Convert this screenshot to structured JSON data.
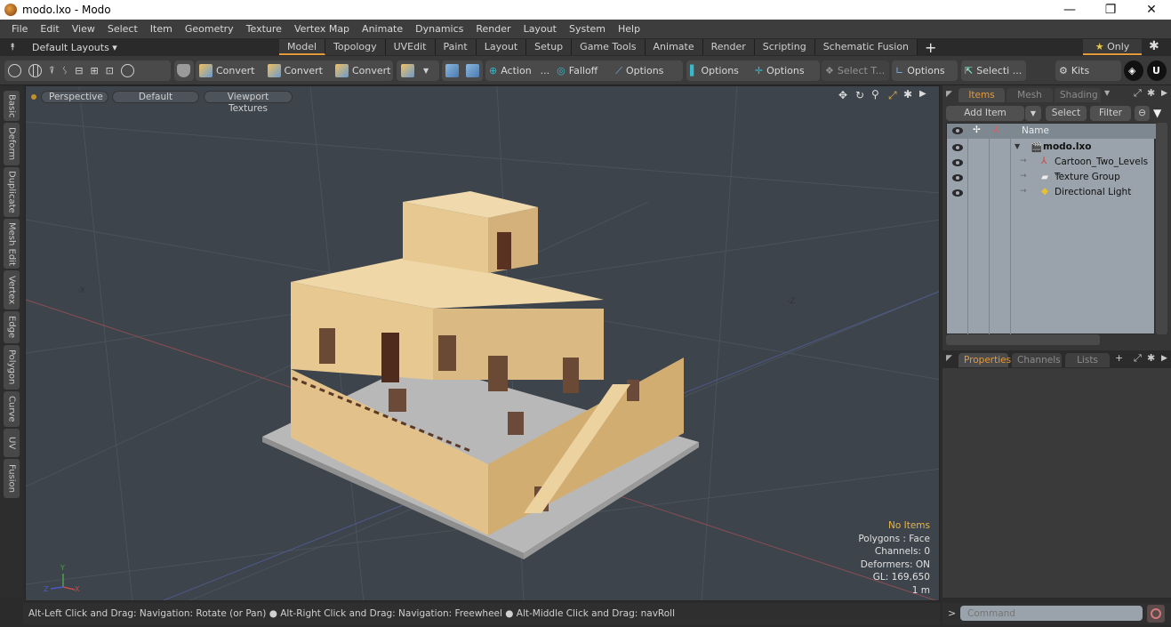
{
  "window": {
    "title": "modo.lxo - Modo",
    "controls": [
      "minimize-icon",
      "restore-icon",
      "close-icon"
    ]
  },
  "menu": [
    "File",
    "Edit",
    "View",
    "Select",
    "Item",
    "Geometry",
    "Texture",
    "Vertex Map",
    "Animate",
    "Dynamics",
    "Render",
    "Layout",
    "System",
    "Help"
  ],
  "layouts": {
    "dropdown_label": "Default Layouts ▾",
    "tabs": [
      "Model",
      "Topology",
      "UVEdit",
      "Paint",
      "Layout",
      "Setup",
      "Game Tools",
      "Animate",
      "Render",
      "Scripting",
      "Schematic Fusion"
    ],
    "active_tab": "Model",
    "add_label": "+",
    "only_label": "Only"
  },
  "toolbar": {
    "convert1": "Convert",
    "convert2": "Convert",
    "convert3": "Convert",
    "action": "Action",
    "action_more": "...",
    "falloff": "Falloff",
    "options1": "Options",
    "options2": "Options",
    "options3": "Options",
    "select_t": "Select T...",
    "options4": "Options",
    "selecti": "Selecti ...",
    "kits": "Kits"
  },
  "side_tabs": [
    "Basic",
    "Deform",
    "Duplicate",
    "Mesh Edit",
    "Vertex",
    "Edge",
    "Polygon",
    "Curve",
    "UV",
    "Fusion"
  ],
  "viewport": {
    "view_mode": "Perspective",
    "shading": "Default",
    "texture_mode": "Viewport Textures",
    "axis_labels": {
      "neg_x": "-X",
      "neg_z": "-Z"
    },
    "stats": {
      "selection": "No Items",
      "polygons": "Polygons : Face",
      "channels": "Channels: 0",
      "deformers": "Deformers: ON",
      "gl": "GL: 169,650",
      "scale": "1 m"
    },
    "colors": {
      "background": "#3d444b",
      "building": "#e3c189",
      "base": "#b5b5b5",
      "accent_axis_x": "#b24a4a",
      "accent_axis_z": "#4a5ab2"
    }
  },
  "items_panel": {
    "tabs": [
      "Items",
      "Mesh ...",
      "Shading"
    ],
    "active_tab": "Items",
    "add_item": "Add Item",
    "select": "Select",
    "filter": "Filter",
    "column_name": "Name",
    "tree": [
      {
        "name": "modo.lxo",
        "level": 0,
        "icon": "scene-icon",
        "bold": true
      },
      {
        "name": "Cartoon_Two_Levels ...",
        "level": 1,
        "icon": "mesh-locator-icon"
      },
      {
        "name": "Texture Group",
        "level": 1,
        "icon": "folder-icon"
      },
      {
        "name": "Directional Light",
        "level": 1,
        "icon": "light-icon"
      }
    ]
  },
  "properties_panel": {
    "tabs": [
      "Properties",
      "Channels",
      "Lists"
    ],
    "active_tab": "Properties",
    "add_label": "+"
  },
  "status_bar": {
    "hint1": "Alt-Left Click and Drag: Navigation: Rotate (or Pan)",
    "hint2": "Alt-Right Click and Drag: Navigation: Freewheel",
    "hint3": "Alt-Middle Click and Drag: navRoll"
  },
  "command": {
    "prompt": ">",
    "placeholder": "Command"
  },
  "accent_color": "#e39a3a"
}
